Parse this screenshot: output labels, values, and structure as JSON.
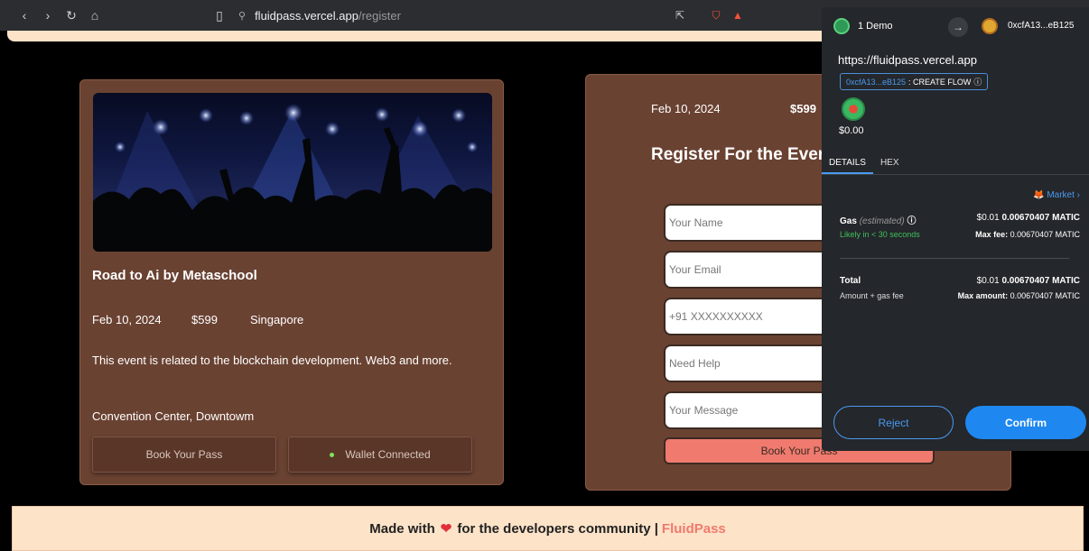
{
  "browser": {
    "url_host": "fluidpass.vercel.app",
    "url_path": "/register"
  },
  "event": {
    "title": "Road to Ai by Metaschool",
    "date": "Feb 10, 2024",
    "price": "$599",
    "location": "Singapore",
    "description": "This event is related to the blockchain development. Web3 and more.",
    "venue": "Convention Center, Downtowm",
    "book_button": "Book Your Pass",
    "wallet_button": "Wallet Connected"
  },
  "register": {
    "date": "Feb 10, 2024",
    "price": "$599",
    "heading": "Register For the Event",
    "name_placeholder": "Your Name",
    "email_placeholder": "Your Email",
    "phone_placeholder": "+91 XXXXXXXXXX",
    "help_placeholder": "Need Help",
    "message_placeholder": "Your Message",
    "submit_label": "Book Your Pass"
  },
  "footer": {
    "text_before": "Made with",
    "heart": "❤",
    "text_after": "for the developers community |",
    "brand": "FluidPass"
  },
  "metamask": {
    "account_name": "1 Demo",
    "dest_address": "0xcfA13...eB125",
    "origin": "https://fluidpass.vercel.app",
    "badge_address": "0xcfA13...eB125",
    "badge_action": ": CREATE FLOW",
    "amount": "$0.00",
    "tabs": [
      "DETAILS",
      "HEX"
    ],
    "market_label": "Market",
    "gas_label": "Gas",
    "gas_estimated": "(estimated)",
    "gas_value_usd": "$0.01",
    "gas_value_matic": "0.00670407 MATIC",
    "gas_likely": "Likely in < 30 seconds",
    "max_fee_label": "Max fee:",
    "max_fee_value": "0.00670407 MATIC",
    "total_label": "Total",
    "total_sub": "Amount + gas fee",
    "total_value_usd": "$0.01",
    "total_value_matic": "0.00670407 MATIC",
    "max_amount_label": "Max amount:",
    "max_amount_value": "0.00670407 MATIC",
    "reject_label": "Reject",
    "confirm_label": "Confirm"
  },
  "colors": {
    "card_bg": "#6a4232",
    "accent": "#f07a6e",
    "metamask_blue": "#1e88f0",
    "success_green": "#3fbf5a"
  }
}
